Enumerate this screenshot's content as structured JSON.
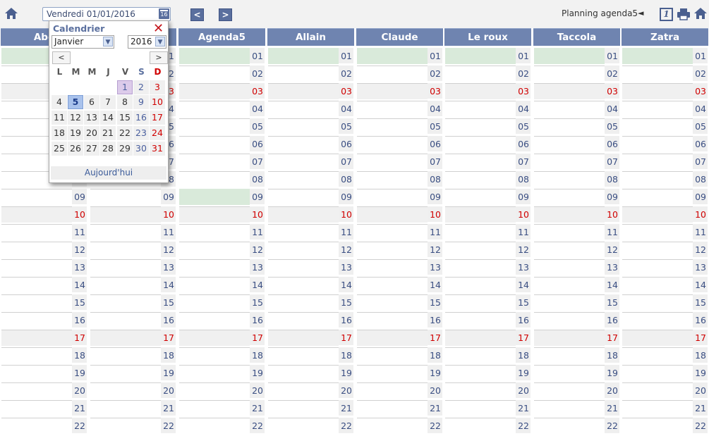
{
  "toolbar": {
    "home_icon": "home-icon",
    "date_value": "Vendredi 01/01/2016",
    "calendar_icon_day": "16",
    "prev_label": "<",
    "next_label": ">",
    "planning_label": "Planning agenda5",
    "planning_arrow": "◄",
    "view_one_label": "1",
    "print_icon": "print-icon"
  },
  "columns": [
    {
      "name": "Abe"
    },
    {
      "name": ""
    },
    {
      "name": "Agenda5"
    },
    {
      "name": "Allain"
    },
    {
      "name": "Claude"
    },
    {
      "name": "Le roux"
    },
    {
      "name": "Taccola"
    },
    {
      "name": "Zatra"
    }
  ],
  "days": [
    "01",
    "02",
    "03",
    "04",
    "05",
    "06",
    "07",
    "08",
    "09",
    "10",
    "11",
    "12",
    "13",
    "14",
    "15",
    "16",
    "17",
    "18",
    "19",
    "20",
    "21",
    "22"
  ],
  "weekend_days": [
    "03",
    "10",
    "17"
  ],
  "highlight": {
    "row01_columns": [
      0,
      2,
      3,
      4,
      5,
      6,
      7
    ],
    "row09_columns": [
      2
    ]
  },
  "calendar_popup": {
    "title": "Calendrier",
    "close": "✕",
    "month": "Janvier",
    "year": "2016",
    "prev": "<",
    "next": ">",
    "weekday_headers": [
      "L",
      "M",
      "M",
      "J",
      "V",
      "S",
      "D"
    ],
    "weeks": [
      [
        "",
        "",
        "",
        "",
        "1",
        "2",
        "3"
      ],
      [
        "4",
        "5",
        "6",
        "7",
        "8",
        "9",
        "10"
      ],
      [
        "11",
        "12",
        "13",
        "14",
        "15",
        "16",
        "17"
      ],
      [
        "18",
        "19",
        "20",
        "21",
        "22",
        "23",
        "24"
      ],
      [
        "25",
        "26",
        "27",
        "28",
        "29",
        "30",
        "31"
      ]
    ],
    "selected_day": "5",
    "first_day": "1",
    "today_label": "Aujourd'hui"
  },
  "colors": {
    "header_bg": "#6f84b0",
    "highlight_bg": "#d9eada",
    "sunday_red": "#d00000",
    "accent_blue": "#5a6f9e"
  }
}
